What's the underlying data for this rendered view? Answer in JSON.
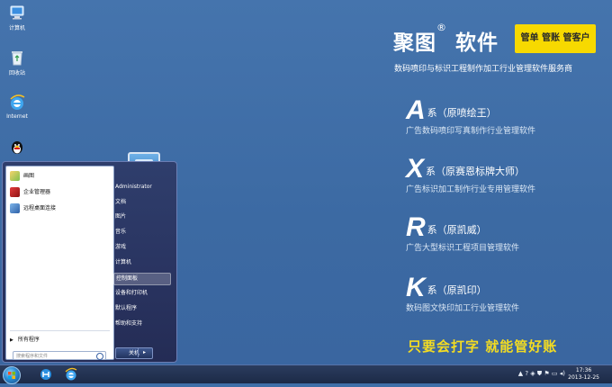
{
  "desktop": {
    "icons": [
      {
        "label": "计算机",
        "icon": "computer-icon"
      },
      {
        "label": "回收站",
        "icon": "recycle-bin-icon"
      },
      {
        "label": "Internet",
        "icon": "internet-explorer-icon"
      },
      {
        "label": "",
        "icon": "qq-penguin-icon"
      }
    ]
  },
  "brand": {
    "title": "聚图",
    "registered": "®",
    "title_suffix": "软件",
    "badge": "管单 管账 管客户",
    "subtitle": "数码喷印与标识工程制作加工行业管理软件服务商",
    "series": [
      {
        "letter": "A",
        "name": "系（原喷绘王）",
        "desc": "广告数码喷印写真制作行业管理软件"
      },
      {
        "letter": "X",
        "name": "系（原赛恩标牌大师）",
        "desc": "广告标识加工制作行业专用管理软件"
      },
      {
        "letter": "R",
        "name": "系（原凯威）",
        "desc": "广告大型标识工程项目管理软件"
      },
      {
        "letter": "K",
        "name": "系（原凯印）",
        "desc": "数码图文快印加工行业管理软件"
      }
    ],
    "slogan": "只要会打字  就能管好账",
    "colors": {
      "accent": "#f7d900",
      "slogan": "#f3dc22",
      "desktop": "#3f6fa8"
    }
  },
  "start_menu": {
    "pinned": [
      {
        "label": "画图",
        "icon": "paint-icon"
      },
      {
        "label": "企业管理器",
        "icon": "enterprise-manager-icon"
      },
      {
        "label": "远程桌面连接",
        "icon": "remote-desktop-icon"
      }
    ],
    "all_programs": "所有程序",
    "search_placeholder": "搜索程序和文件",
    "right_items": [
      "Administrator",
      "文档",
      "图片",
      "音乐",
      "游戏",
      "计算机",
      "控制面板",
      "设备和打印机",
      "默认程序",
      "帮助和支持"
    ],
    "active_item": "控制面板",
    "shutdown": "关机"
  },
  "taskbar": {
    "buttons": [
      "start-orb-icon",
      "app-icon",
      "internet-explorer-icon"
    ],
    "clock_time": "17:36",
    "clock_date": "2013-12-25"
  }
}
